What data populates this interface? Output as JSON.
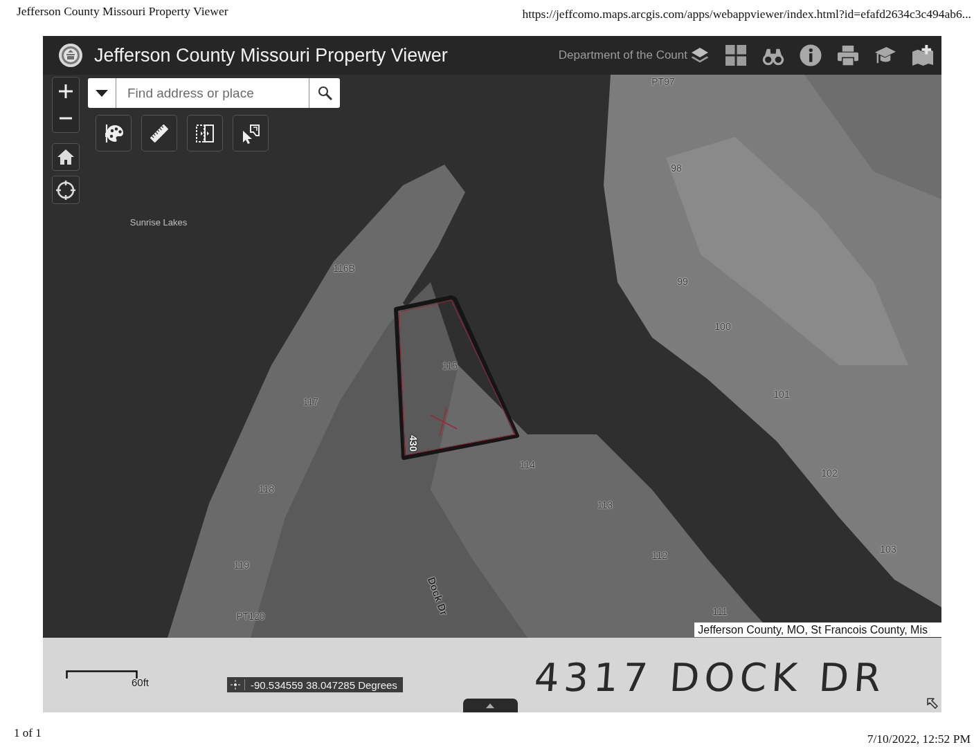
{
  "print_header": {
    "title": "Jefferson County Missouri Property Viewer",
    "url": "https://jeffcomo.maps.arcgis.com/apps/webappviewer/index.html?id=efafd2634c3c494ab6..."
  },
  "app_header": {
    "title": "Jefferson County Missouri Property Viewer",
    "subtitle": "Department of the Count"
  },
  "search": {
    "placeholder": "Find address or place"
  },
  "map": {
    "labels": [
      {
        "text": "PT97",
        "kind": "parcel"
      },
      {
        "text": "98",
        "kind": "parcel"
      },
      {
        "text": "Sunrise Lakes",
        "kind": "place"
      },
      {
        "text": "116B",
        "kind": "parcel"
      },
      {
        "text": "99",
        "kind": "parcel"
      },
      {
        "text": "100",
        "kind": "parcel"
      },
      {
        "text": "115",
        "kind": "parcel"
      },
      {
        "text": "101",
        "kind": "parcel"
      },
      {
        "text": "117",
        "kind": "parcel"
      },
      {
        "text": "430",
        "kind": "address"
      },
      {
        "text": "114",
        "kind": "parcel"
      },
      {
        "text": "102",
        "kind": "parcel"
      },
      {
        "text": "118",
        "kind": "parcel"
      },
      {
        "text": "113",
        "kind": "parcel"
      },
      {
        "text": "103",
        "kind": "parcel"
      },
      {
        "text": "112",
        "kind": "parcel"
      },
      {
        "text": "119",
        "kind": "parcel"
      },
      {
        "text": "Dock Dr",
        "kind": "road"
      },
      {
        "text": "111",
        "kind": "parcel"
      },
      {
        "text": "PT120",
        "kind": "parcel"
      }
    ],
    "attribution": "Jefferson County, MO, St Francois County, Mis"
  },
  "status_bar": {
    "scale": "60ft",
    "coordinates": "-90.534559 38.047285 Degrees",
    "handwritten_note": "4317 DOCK DR"
  },
  "print_footer": {
    "page": "1 of 1",
    "timestamp": "7/10/2022, 12:52 PM"
  }
}
